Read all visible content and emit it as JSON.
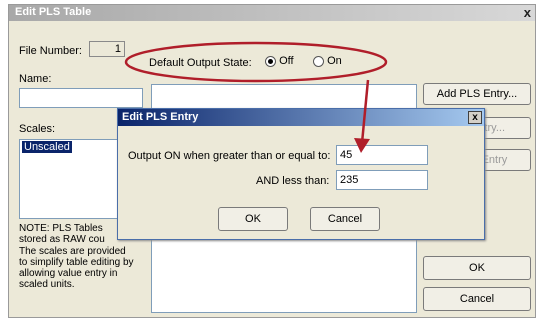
{
  "window": {
    "title": "Edit PLS Table",
    "close_glyph": "x",
    "file_number_label": "File Number:",
    "file_number_value": "1",
    "default_output_state_label": "Default Output State:",
    "output_state_options": [
      "Off",
      "On"
    ],
    "output_state_selected": "Off",
    "name_label": "Name:",
    "name_value": "",
    "scales_label": "Scales:",
    "scales_items": [
      "Unscaled"
    ],
    "buttons": {
      "add_entry": "Add PLS Entry...",
      "edit_entry": "Edit Entry...",
      "delete_entry": "Delete Entry",
      "ok": "OK",
      "cancel": "Cancel"
    },
    "note_lines": [
      "NOTE: PLS Tables",
      "stored as RAW cou",
      "The scales are provided",
      "to simplify table editing by",
      "allowing value entry in",
      "scaled units."
    ]
  },
  "dialog": {
    "title": "Edit PLS Entry",
    "close_glyph": "x",
    "greater_label": "Output ON when greater than or equal to:",
    "greater_value": "45",
    "less_label": "AND less than:",
    "less_value": "235",
    "ok": "OK",
    "cancel": "Cancel"
  },
  "annotation": {
    "ellipse_color": "#b01e2a",
    "arrow_color": "#b01e2a"
  }
}
